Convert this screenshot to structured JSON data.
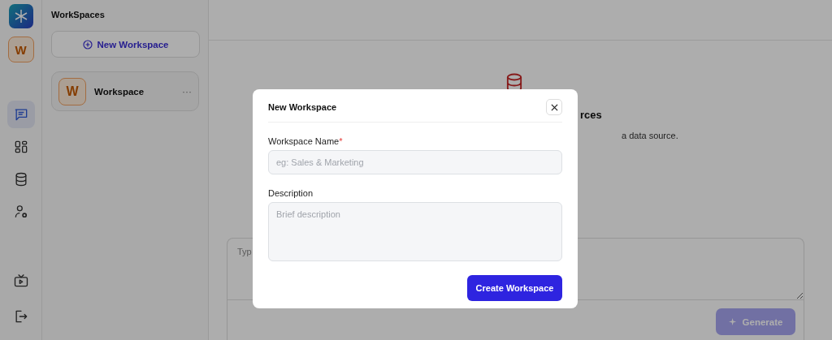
{
  "rail": {
    "avatar": "W",
    "nav": [
      {
        "kind": "chat",
        "selected": true
      },
      {
        "kind": "grid",
        "selected": false
      },
      {
        "kind": "database",
        "selected": false
      },
      {
        "kind": "user-settings",
        "selected": false
      }
    ],
    "bottom": [
      {
        "kind": "tv"
      },
      {
        "kind": "logout"
      }
    ]
  },
  "sidebar": {
    "title": "WorkSpaces",
    "new_button": "New Workspace",
    "workspaces": [
      {
        "avatar": "W",
        "name": "Workspace",
        "menu": "···"
      }
    ]
  },
  "main": {
    "heading_fragment": "rces",
    "subtitle_fragment": "a data source.",
    "prompt": {
      "placeholder": "Typ",
      "button": "Generate",
      "disabled": true
    }
  },
  "modal": {
    "title": "New Workspace",
    "fields": [
      {
        "kind": "input",
        "label": "Workspace Name",
        "required_mark": "*",
        "placeholder": "eg: Sales & Marketing"
      },
      {
        "kind": "textarea",
        "label": "Description",
        "placeholder": "Brief description"
      }
    ],
    "submit": "Create Workspace"
  }
}
